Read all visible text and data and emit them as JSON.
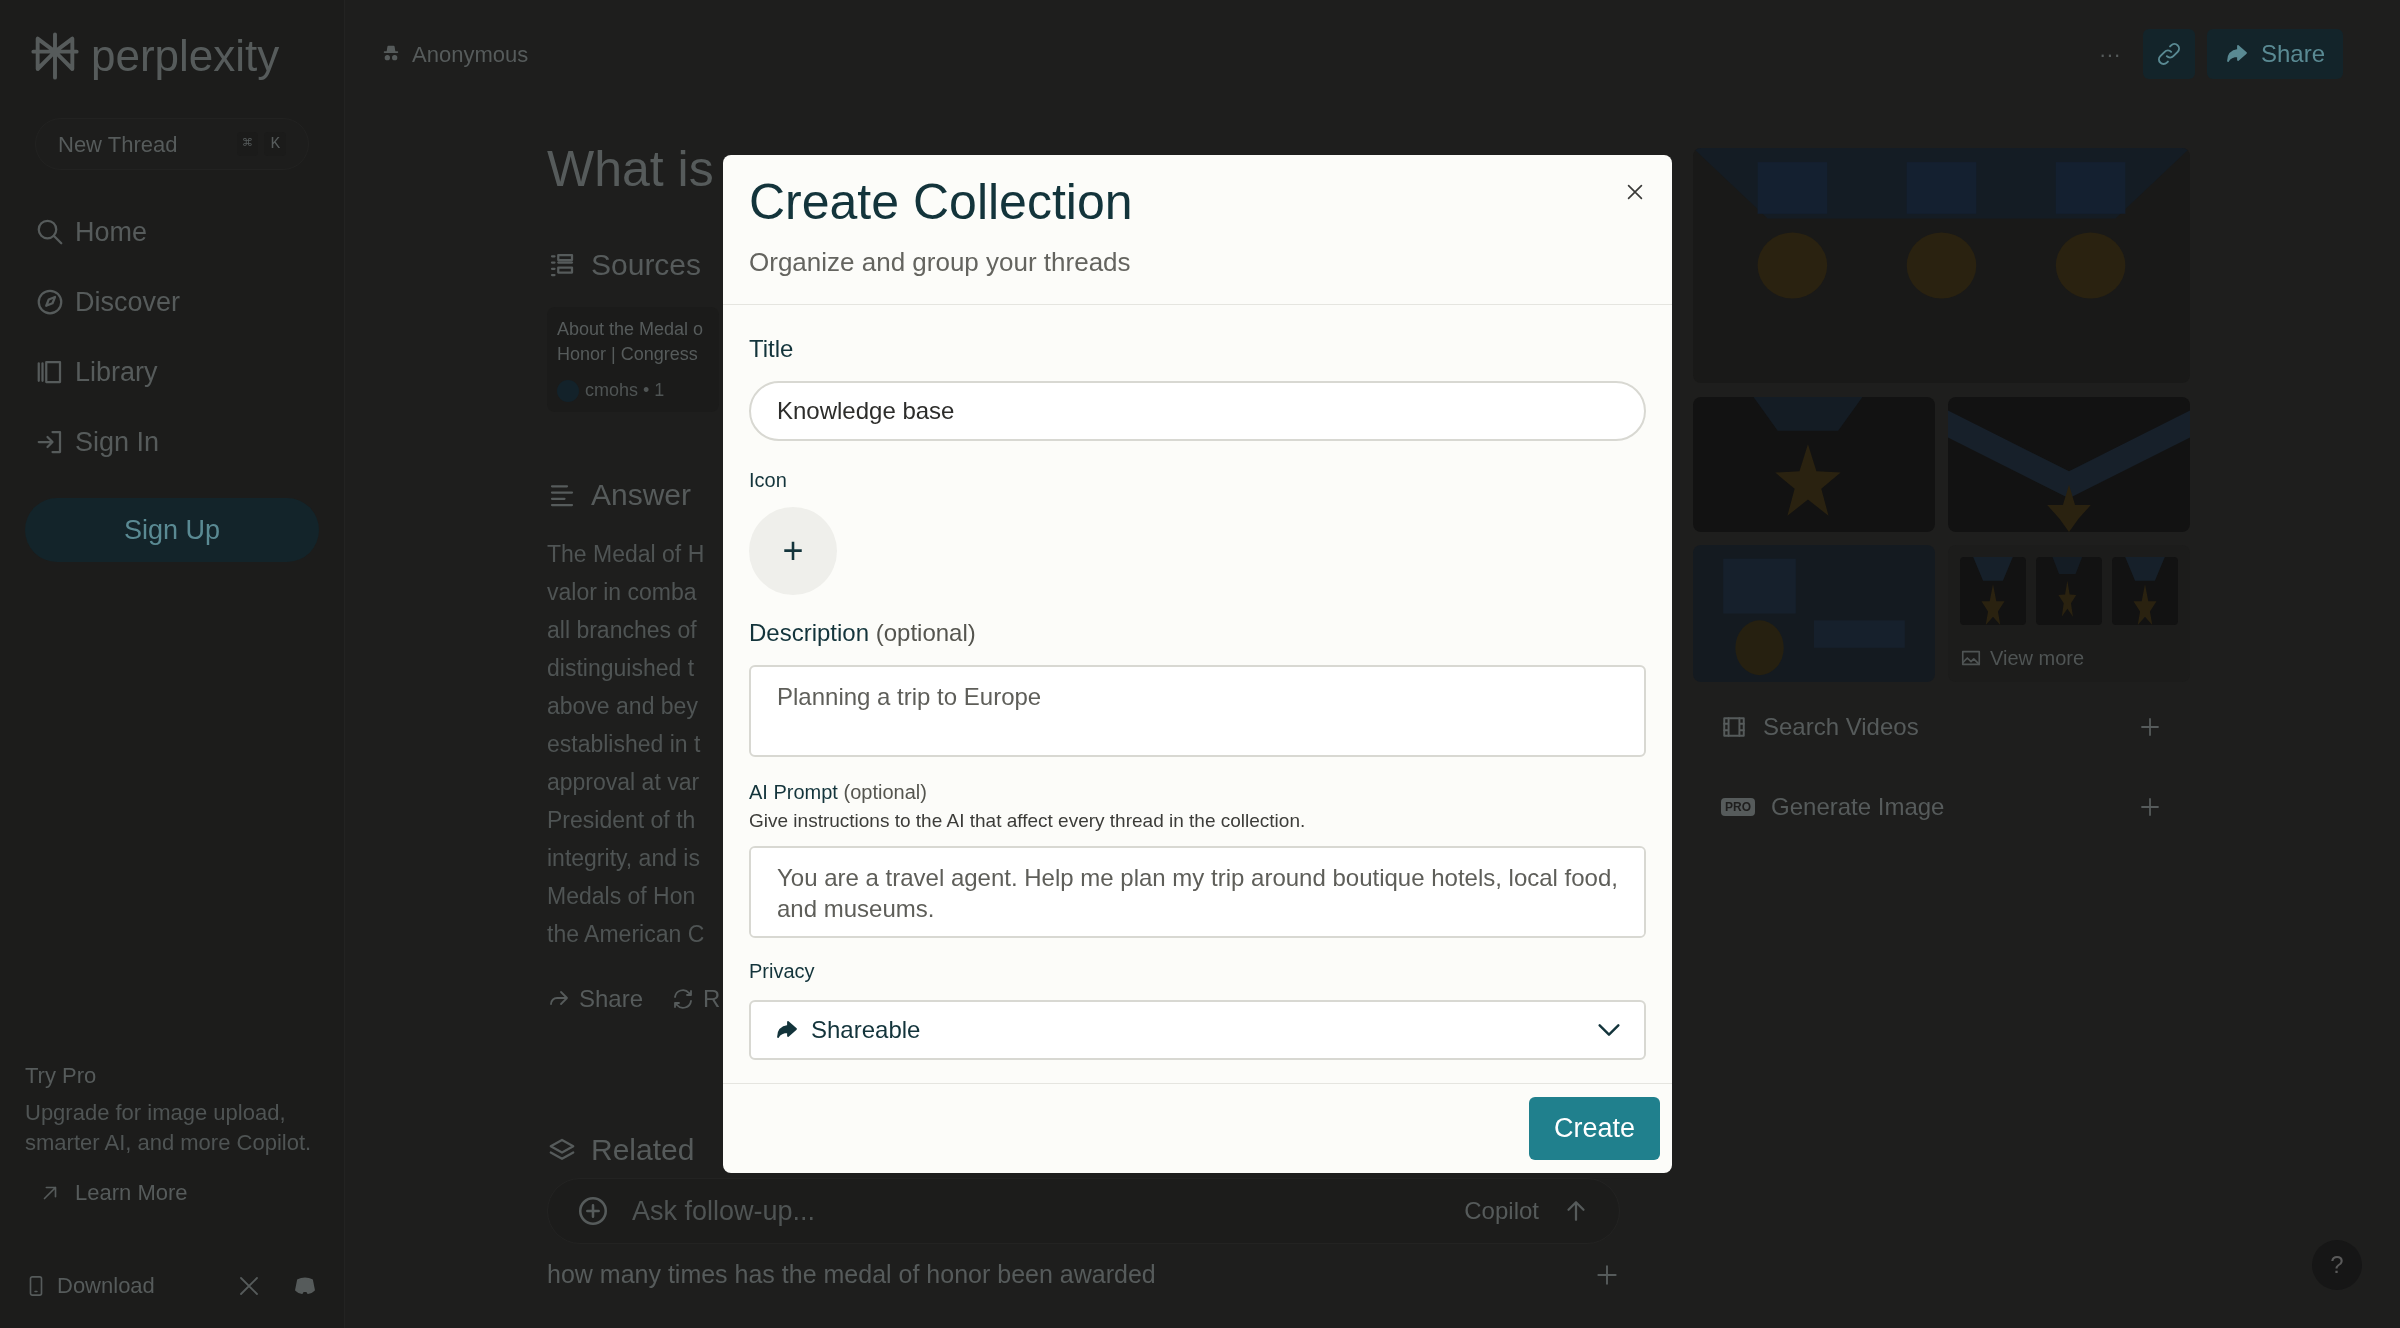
{
  "sidebar": {
    "logo": "perplexity",
    "new_thread": {
      "label": "New Thread",
      "keys": [
        "⌘",
        "K"
      ]
    },
    "nav": [
      {
        "label": "Home",
        "kind": "search"
      },
      {
        "label": "Discover",
        "kind": "compass"
      },
      {
        "label": "Library",
        "kind": "library"
      },
      {
        "label": "Sign In",
        "kind": "signin"
      }
    ],
    "sign_up": "Sign Up",
    "promo": {
      "title": "Try Pro",
      "text": "Upgrade for image upload, smarter AI, and more Copilot.",
      "link": "Learn More"
    },
    "download": "Download"
  },
  "header": {
    "user": "Anonymous",
    "more": "···",
    "share": "Share"
  },
  "thread": {
    "title": "What is",
    "sources_heading": "Sources",
    "source_card": {
      "lines": [
        "About the Medal o",
        "Honor | Congress"
      ],
      "meta": "cmohs • 1"
    },
    "answer_heading": "Answer",
    "answer_lines": [
      "The Medal of H",
      "valor in comba",
      "all branches of",
      "distinguished t",
      "above and bey",
      "established in t",
      "approval at var",
      "President of th",
      "integrity, and is",
      "Medals of Hon",
      "the American C"
    ],
    "actions": [
      {
        "label": "Share",
        "kind": "share"
      },
      {
        "label": "R",
        "kind": "rewrite"
      }
    ],
    "related_heading": "Related",
    "ask": {
      "placeholder": "Ask follow-up...",
      "copilot": "Copilot"
    },
    "related": [
      "how many times has the medal of honor been awarded"
    ]
  },
  "media": {
    "view_more": "View more",
    "actions": [
      {
        "label": "Search Videos",
        "kind": "video"
      },
      {
        "label": "Generate Image",
        "kind": "pro",
        "badge": "PRO"
      }
    ]
  },
  "help": "?",
  "modal": {
    "title": "Create Collection",
    "subtitle": "Organize and group your threads",
    "title_field": {
      "label": "Title",
      "value": "Knowledge base"
    },
    "icon_field": {
      "label": "Icon",
      "button": "+"
    },
    "description": {
      "label": "Description",
      "optional": "(optional)",
      "placeholder": "Planning a trip to Europe"
    },
    "prompt": {
      "label": "AI Prompt",
      "optional": "(optional)",
      "help": "Give instructions to the AI that affect every thread in the collection.",
      "placeholder": "You are a travel agent. Help me plan my trip around boutique hotels, local food, and museums."
    },
    "privacy": {
      "label": "Privacy",
      "value": "Shareable"
    },
    "create": "Create"
  }
}
